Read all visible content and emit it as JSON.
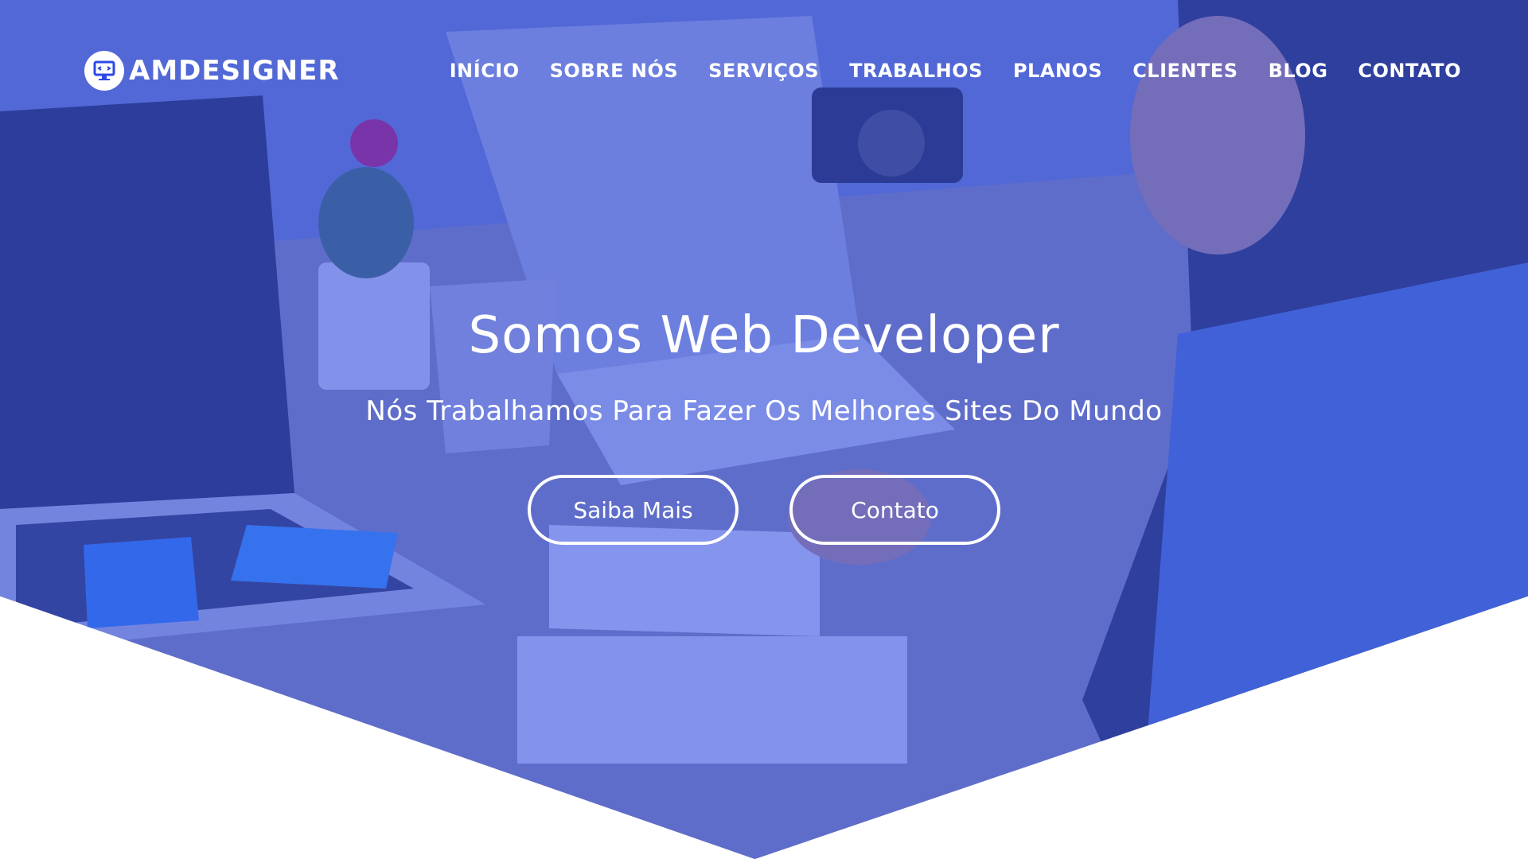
{
  "brand": {
    "name": "AMDESIGNER",
    "icon": "monitor-code-icon"
  },
  "nav": {
    "items": [
      {
        "label": "INÍCIO"
      },
      {
        "label": "SOBRE NÓS"
      },
      {
        "label": "SERVIÇOS"
      },
      {
        "label": "TRABALHOS"
      },
      {
        "label": "PLANOS"
      },
      {
        "label": "CLIENTES"
      },
      {
        "label": "BLOG"
      },
      {
        "label": "CONTATO"
      }
    ]
  },
  "hero": {
    "title": "Somos Web Developer",
    "subtitle": "Nós Trabalhamos Para Fazer Os Melhores Sites Do Mundo",
    "buttons": [
      {
        "label": "Saiba Mais"
      },
      {
        "label": "Contato"
      }
    ]
  },
  "colors": {
    "overlay": "#2d48e6",
    "text": "#ffffff",
    "background": "#ffffff"
  }
}
